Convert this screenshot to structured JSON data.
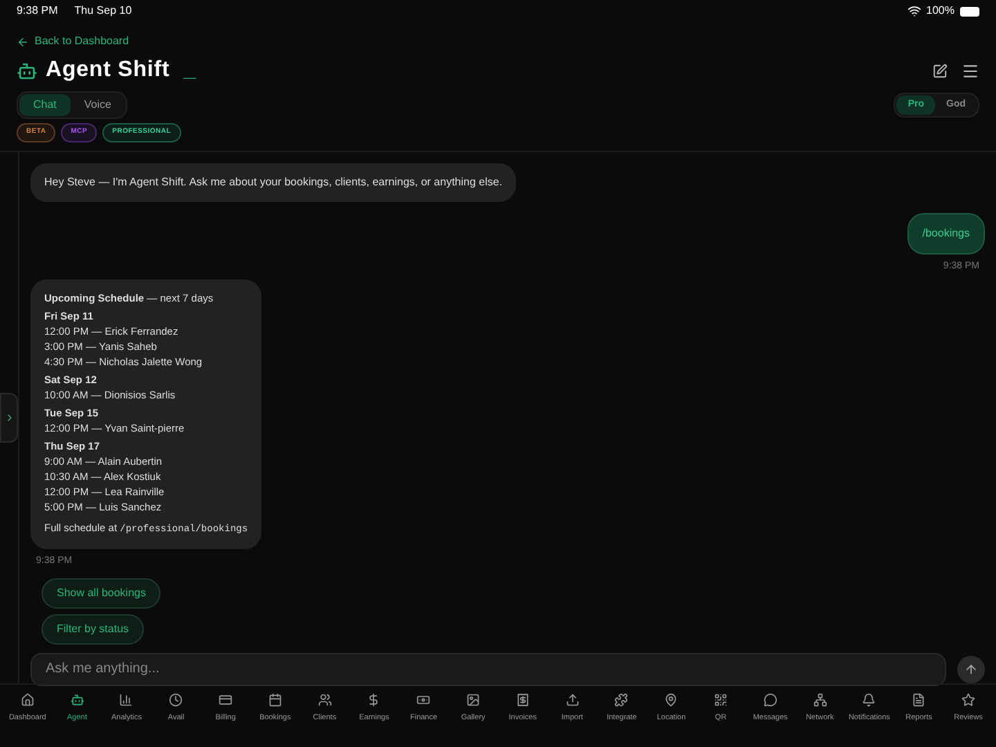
{
  "status_bar": {
    "time": "9:38 PM",
    "date": "Thu Sep 10",
    "battery": "100%"
  },
  "header": {
    "back_link": "Back to Dashboard",
    "title": "Agent Shift",
    "cursor": "_"
  },
  "mode_tabs": [
    {
      "label": "Chat",
      "selected": true
    },
    {
      "label": "Voice",
      "selected": false
    }
  ],
  "tier_toggle": [
    {
      "label": "Pro",
      "selected": true
    },
    {
      "label": "God",
      "selected": false
    }
  ],
  "badges": [
    {
      "label": "BETA",
      "color": "#d9823b"
    },
    {
      "label": "MCP",
      "color": "#a855f7"
    },
    {
      "label": "PROFESSIONAL",
      "color": "#34d399"
    }
  ],
  "messages": [
    {
      "kind": "agent_text",
      "text": "Hey Steve — I'm Agent Shift. Ask me about your bookings, clients, earnings, or anything else."
    },
    {
      "kind": "user",
      "text": "/bookings",
      "time": "9:38 PM"
    },
    {
      "kind": "agent_schedule",
      "heading": "**Upcoming Schedule** — next 7 days",
      "days": [
        {
          "day": "Fri Sep 11",
          "entries": [
            "12:00 PM — Erick Ferrandez",
            "3:00 PM — Yanis Saheb",
            "4:30 PM — Nicholas Jalette Wong"
          ]
        },
        {
          "day": "Sat Sep 12",
          "entries": [
            "10:00 AM — Dionisios Sarlis"
          ]
        },
        {
          "day": "Tue Sep 15",
          "entries": [
            "12:00 PM — Yvan Saint-pierre"
          ]
        },
        {
          "day": "Thu Sep 17",
          "entries": [
            "9:00 AM — Alain Aubertin",
            "10:30 AM — Alex Kostiuk",
            "12:00 PM — Lea Rainville",
            "5:00 PM — Luis Sanchez"
          ]
        }
      ],
      "footer_text": "Full schedule at",
      "footer_path": "/professional/bookings",
      "time": "9:38 PM"
    }
  ],
  "suggestions": [
    "Show all bookings",
    "Filter by status"
  ],
  "composer": {
    "placeholder": "Ask me anything..."
  },
  "nav": [
    {
      "label": "Dashboard",
      "selected": false
    },
    {
      "label": "Agent",
      "selected": true
    },
    {
      "label": "Analytics",
      "selected": false
    },
    {
      "label": "Avail",
      "selected": false
    },
    {
      "label": "Billing",
      "selected": false
    },
    {
      "label": "Bookings",
      "selected": false
    },
    {
      "label": "Clients",
      "selected": false
    },
    {
      "label": "Earnings",
      "selected": false
    },
    {
      "label": "Finance",
      "selected": false
    },
    {
      "label": "Gallery",
      "selected": false
    },
    {
      "label": "Invoices",
      "selected": false
    },
    {
      "label": "Import",
      "selected": false
    },
    {
      "label": "Integrate",
      "selected": false
    },
    {
      "label": "Location",
      "selected": false
    },
    {
      "label": "QR",
      "selected": false
    },
    {
      "label": "Messages",
      "selected": false
    },
    {
      "label": "Network",
      "selected": false
    },
    {
      "label": "Notifications",
      "selected": false
    },
    {
      "label": "Reports",
      "selected": false
    },
    {
      "label": "Reviews",
      "selected": false
    }
  ]
}
